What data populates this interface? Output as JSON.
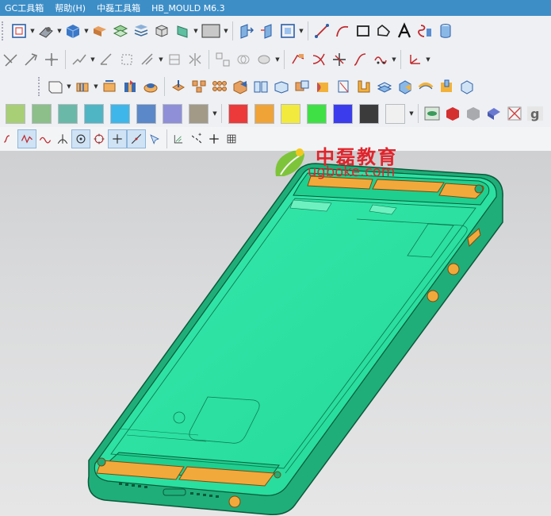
{
  "menu": {
    "items": [
      "GC工具箱",
      "帮助(H)",
      "中磊工具箱",
      "HB_MOULD M6.3"
    ]
  },
  "colors": {
    "swatches_row1": [
      "#a8cf76",
      "#8cbf8a",
      "#6ab8a8",
      "#4fb5c5",
      "#3fb6ea",
      "#5b88c8",
      "#8f8fd8",
      "#a29a86"
    ],
    "swatches_row2": [
      "#ec3a3a",
      "#f0a336",
      "#f2ea3c",
      "#3fe046",
      "#3b3dec",
      "#3b3b3b",
      "#f0f0f0"
    ],
    "part_body": "#2fe3a3",
    "part_board": "#f2a93b",
    "brand_red": "#e0242c"
  },
  "brand": {
    "name_cn": "中磊教育",
    "url": "ugboke.com"
  },
  "icons": {
    "row1": [
      "zoom-fit-icon",
      "view-orient-icon",
      "shaded-cube-icon",
      "part-icon",
      "layer-icon",
      "layer-stack-icon",
      "object-icon",
      "section-icon",
      "color-box-icon",
      "view-triad-icon",
      "view-triad2-icon",
      "frame-icon",
      "line-icon",
      "arc-icon",
      "rectangle-icon",
      "spline-shape-icon",
      "text-icon",
      "measure-icon",
      "cylinder-icon"
    ],
    "row2": [
      "trim-icon",
      "extend-icon",
      "split-icon",
      "sketch-tools-icon",
      "dimension-icon",
      "angle-dim-icon",
      "constraint-icon",
      "align-icon",
      "mirror-icon",
      "pattern-icon",
      "offset-icon",
      "fillet-tool-icon",
      "curve-icon",
      "intersect-icon",
      "bridge-icon",
      "surface-curve-icon",
      "analysis-icon"
    ],
    "row3": [
      "datum-plane-icon",
      "extrude-icon",
      "revolve-icon",
      "hole-icon",
      "boss-icon",
      "pocket-icon",
      "pattern-feature-icon",
      "rib-icon",
      "box-icon",
      "book-icon",
      "block-icon",
      "union-icon",
      "subtract-icon",
      "shell-icon",
      "draft-icon",
      "offset-face-icon",
      "replace-face-icon",
      "tube-icon",
      "sweep-icon"
    ],
    "row5": [
      "curve-snap-icon",
      "point-on-curve-icon",
      "wave-icon",
      "intersection-point-icon",
      "center-point-icon",
      "circle-point-icon",
      "cross-point-icon",
      "line-point-icon",
      "pick-icon",
      "filter-icon",
      "points-icon",
      "plus-icon",
      "grid-icon"
    ]
  }
}
